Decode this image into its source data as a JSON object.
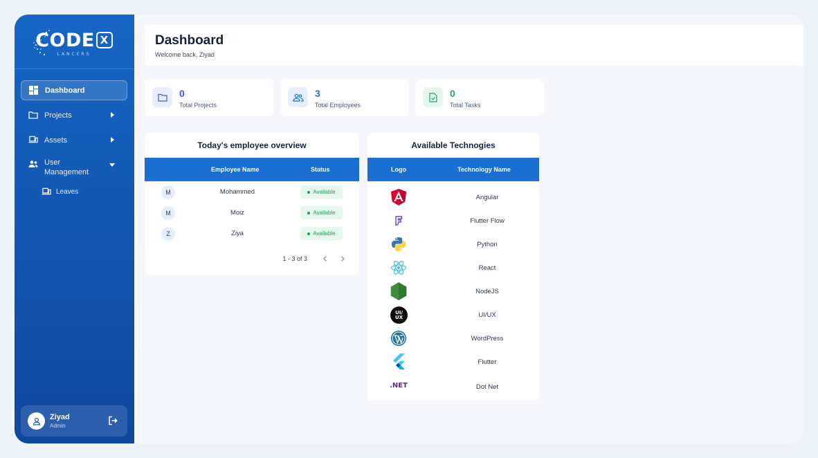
{
  "brand": {
    "name_main": "CODE",
    "name_x": "X",
    "name_sub": "LANCERS"
  },
  "sidebar": {
    "items": [
      {
        "label": "Dashboard",
        "icon": "dashboard-icon"
      },
      {
        "label": "Projects",
        "icon": "folder-icon"
      },
      {
        "label": "Assets",
        "icon": "laptop-icon"
      },
      {
        "label": "User Management",
        "icon": "users-icon"
      }
    ],
    "sub_items": [
      {
        "label": "Leaves",
        "icon": "laptop-icon"
      }
    ],
    "user": {
      "name": "Ziyad",
      "role": "Admin"
    }
  },
  "header": {
    "title": "Dashboard",
    "welcome": "Welcome back, Ziyad"
  },
  "stats": [
    {
      "value": "0",
      "label": "Total Projects",
      "color": "#3f5bd8"
    },
    {
      "value": "3",
      "label": "Total Employees",
      "color": "#1a6fd1"
    },
    {
      "value": "0",
      "label": "Total Tasks",
      "color": "#1fa46b"
    }
  ],
  "employees": {
    "title": "Today's employee overview",
    "headers": [
      "Employee Name",
      "Status"
    ],
    "rows": [
      {
        "initial": "M",
        "name": "Mohammed",
        "status": "Available"
      },
      {
        "initial": "M",
        "name": "Moiz",
        "status": "Available"
      },
      {
        "initial": "Z",
        "name": "Ziya",
        "status": "Available"
      }
    ],
    "pagination": "1 - 3 of 3"
  },
  "technologies": {
    "title": "Available Technogies",
    "headers": [
      "Logo",
      "Technology Name"
    ],
    "rows": [
      {
        "name": "Angular",
        "logo": "angular-logo"
      },
      {
        "name": "Flutter Flow",
        "logo": "flutterflow-logo"
      },
      {
        "name": "Python",
        "logo": "python-logo"
      },
      {
        "name": "React",
        "logo": "react-logo"
      },
      {
        "name": "NodeJS",
        "logo": "nodejs-logo"
      },
      {
        "name": "UI/UX",
        "logo": "uiux-logo"
      },
      {
        "name": "WordPress",
        "logo": "wordpress-logo"
      },
      {
        "name": "Flutter",
        "logo": "flutter-logo"
      },
      {
        "name": "Dot Net",
        "logo": "dotnet-logo"
      }
    ],
    "uiux_text": [
      "UI/",
      "UX"
    ],
    "dotnet_text": ".NET"
  }
}
